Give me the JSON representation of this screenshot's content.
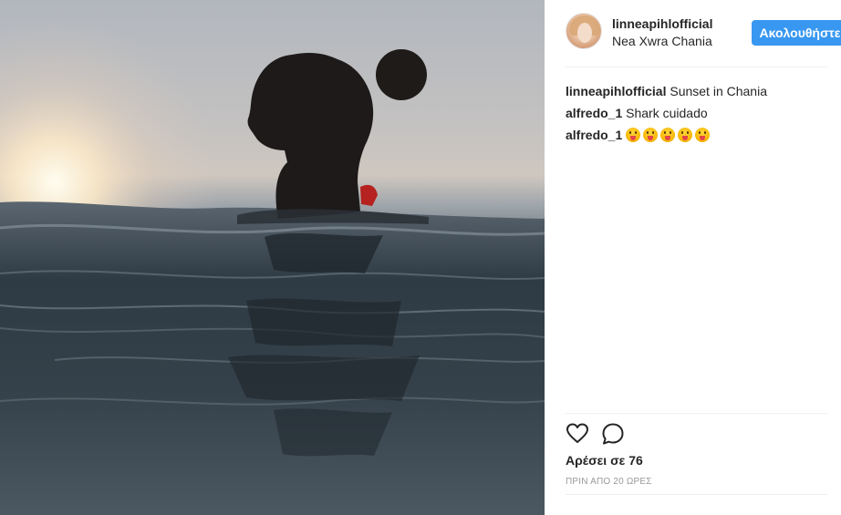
{
  "post": {
    "photo_name": "woman-swimming-at-sunset"
  },
  "header": {
    "username": "linneapihlofficial",
    "location": "Nea Xwra Chania",
    "follow_label": "Ακολουθήστε",
    "follow_color": "#3897f0"
  },
  "comments": [
    {
      "author": "linneapihlofficial",
      "text": "Sunset in Chania"
    },
    {
      "author": "alfredo_1",
      "text": "Shark cuidado"
    },
    {
      "author": "alfredo_1",
      "text": "",
      "emoji_count": 5,
      "emoji": "tongue-out-emoji"
    }
  ],
  "actions": {
    "like_icon": "heart-icon",
    "comment_icon": "comment-bubble-icon"
  },
  "likes_text": "Αρέσει σε 76",
  "timestamp": "ΠΡΙΝ ΑΠΟ 20 ΩΡΕΣ"
}
